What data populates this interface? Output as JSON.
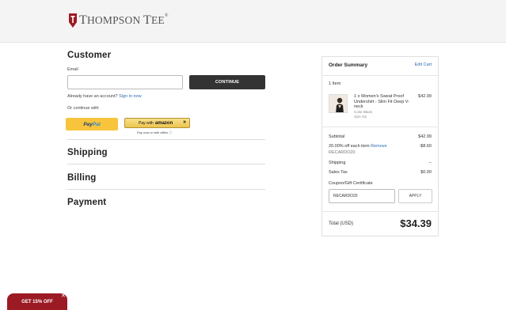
{
  "brand": {
    "name_first": "T",
    "name_rest": "HOMPSON ",
    "name_second": "T",
    "name_rest2": "EE",
    "mark": "®"
  },
  "customer": {
    "heading": "Customer",
    "email_label": "Email",
    "email_value": "",
    "continue_label": "CONTINUE",
    "account_prompt": "Already have an account?",
    "sign_in_label": "Sign in now",
    "continue_with": "Or continue with",
    "paypal_part1": "Pay",
    "paypal_part2": "Pal",
    "amazon_prefix": "Pay with",
    "amazon_brand": "amazon",
    "amazon_arrow": "»",
    "affirm_text": "Pay now or with affirm ⓘ"
  },
  "sections": {
    "shipping": "Shipping",
    "billing": "Billing",
    "payment": "Payment"
  },
  "summary": {
    "title": "Order Summary",
    "edit_cart": "Edit Cart",
    "item_count": "1 Item",
    "item": {
      "name": "1 x Women's Sweat Proof Undershirt - Slim Fit Deep V-neck",
      "color": "Color Black",
      "size": "Size XS",
      "price": "$42.99"
    },
    "subtotal_label": "Subtotal",
    "subtotal_value": "$42.99",
    "discount_label": "20.00% off each item",
    "remove_label": "Remove",
    "discount_value": "-$8.60",
    "discount_code": "RECARDO20",
    "shipping_label": "Shipping",
    "shipping_value": "--",
    "tax_label": "Sales Tax",
    "tax_value": "$0.00",
    "coupon_label": "Coupon/Gift Certificate",
    "coupon_value": "RECARDO20",
    "apply_label": "APPLY",
    "total_label": "Total (USD)",
    "total_value": "$34.39"
  },
  "promo": {
    "label": "GET 15% OFF",
    "close": "✕"
  },
  "colors": {
    "brand_red": "#9c1a24",
    "link_blue": "#2c6ab4",
    "button_dark": "#333333"
  }
}
